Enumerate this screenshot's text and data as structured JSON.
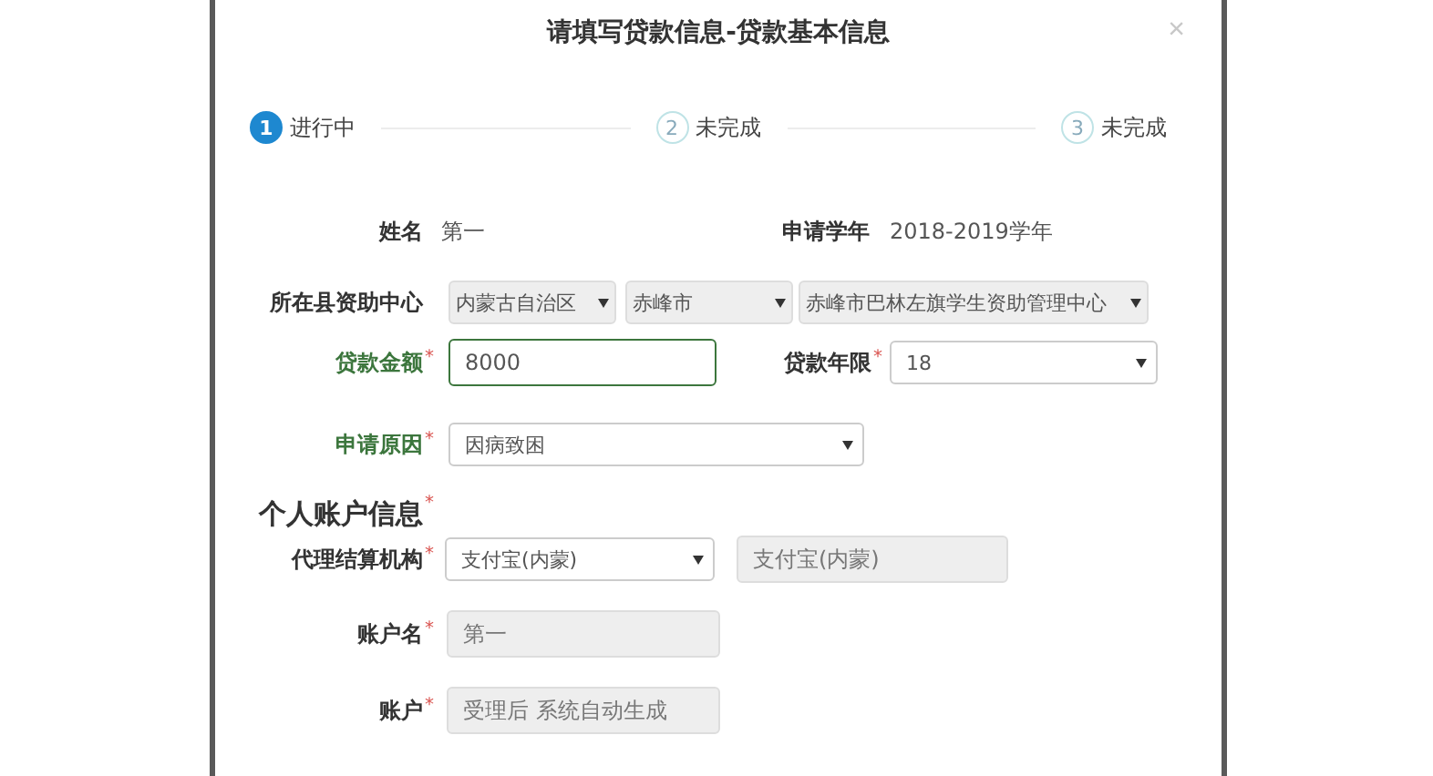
{
  "dialog": {
    "title": "请填写贷款信息-贷款基本信息",
    "close": "×"
  },
  "steps": [
    {
      "number": "1",
      "label": "进行中",
      "selected": true
    },
    {
      "number": "2",
      "label": "未完成",
      "selected": false
    },
    {
      "number": "3",
      "label": "未完成",
      "selected": false
    }
  ],
  "loan_rows": [
    [
      {
        "kind": "label",
        "text": "姓名",
        "valid": false
      },
      {
        "kind": "text",
        "value": "第一"
      },
      {
        "kind": "label",
        "text": "申请学年",
        "valid": false
      },
      {
        "kind": "text",
        "value": "2018-2019学年"
      }
    ],
    [
      {
        "kind": "label",
        "text": "所在县资助中心",
        "valid": false
      },
      {
        "kind": "select",
        "value": "内蒙古自治区",
        "disabled": true
      },
      {
        "kind": "select",
        "value": "赤峰市",
        "disabled": true
      },
      {
        "kind": "select",
        "value": "赤峰市巴林左旗学生资助管理中心",
        "disabled": true
      }
    ],
    [
      {
        "kind": "label",
        "text": "贷款金额",
        "required_mark": "*",
        "valid": true
      },
      {
        "kind": "input",
        "value": "8000",
        "readonly": false,
        "focused": true
      },
      {
        "kind": "label",
        "text": "贷款年限",
        "required_mark": "*",
        "valid": false
      },
      {
        "kind": "select",
        "value": "18",
        "disabled": false
      }
    ],
    [
      {
        "kind": "label",
        "text": "申请原因",
        "required_mark": "*",
        "valid": true
      },
      {
        "kind": "select",
        "value": "因病致困",
        "disabled": false
      }
    ]
  ],
  "section_heading": {
    "text": "个人账户信息",
    "required_mark": "*"
  },
  "account_rows": [
    [
      {
        "kind": "label",
        "text": "代理结算机构",
        "required_mark": "*",
        "valid": false
      },
      {
        "kind": "select",
        "value": "支付宝(内蒙)",
        "disabled": false
      },
      {
        "kind": "input",
        "value": "支付宝(内蒙)",
        "readonly": true,
        "focused": false
      }
    ],
    [
      {
        "kind": "label",
        "text": "账户名",
        "required_mark": "*",
        "valid": false
      },
      {
        "kind": "input",
        "value": "第一",
        "readonly": true,
        "focused": false
      }
    ],
    [
      {
        "kind": "label",
        "text": "账户",
        "required_mark": "*",
        "valid": false
      },
      {
        "kind": "input",
        "value": "受理后 系统自动生成",
        "readonly": true,
        "focused": false
      }
    ]
  ]
}
